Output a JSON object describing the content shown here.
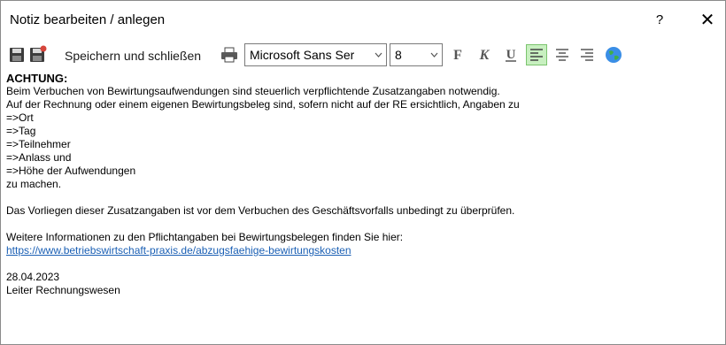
{
  "window": {
    "title": "Notiz bearbeiten / anlegen",
    "help": "?",
    "close": "✕"
  },
  "toolbar": {
    "save_close_label": "Speichern und schließen",
    "font_family": "Microsoft Sans Ser",
    "font_size": "8",
    "active_alignment": "left",
    "icons": [
      "save-icon",
      "save-new-icon",
      "print-icon",
      "bold-icon",
      "italic-icon",
      "underline-icon",
      "align-left-icon",
      "align-center-icon",
      "align-right-icon",
      "globe-icon"
    ]
  },
  "note": {
    "heading": "ACHTUNG:",
    "line1": "Beim Verbuchen von Bewirtungsaufwendungen sind steuerlich verpflichtende Zusatzangaben notwendig.",
    "line2": "Auf der Rechnung oder einem eigenen Bewirtungsbeleg sind, sofern nicht auf der RE ersichtlich, Angaben zu",
    "items": [
      "=>Ort",
      "=>Tag",
      "=>Teilnehmer",
      "=>Anlass und",
      "=>Höhe der Aufwendungen"
    ],
    "line3": "zu machen.",
    "para2": "Das Vorliegen dieser Zusatzangaben ist vor dem Verbuchen des Geschäftsvorfalls unbedingt zu überprüfen.",
    "para3": "Weitere Informationen zu den Pflichtangaben bei Bewirtungsbelegen finden Sie hier:",
    "link": "https://www.betriebswirtschaft-praxis.de/abzugsfaehige-bewirtungskosten",
    "date": "28.04.2023",
    "signature": "Leiter Rechnungswesen"
  },
  "colors": {
    "link": "#1a5fb4",
    "active_button": "#c8f0c0"
  }
}
